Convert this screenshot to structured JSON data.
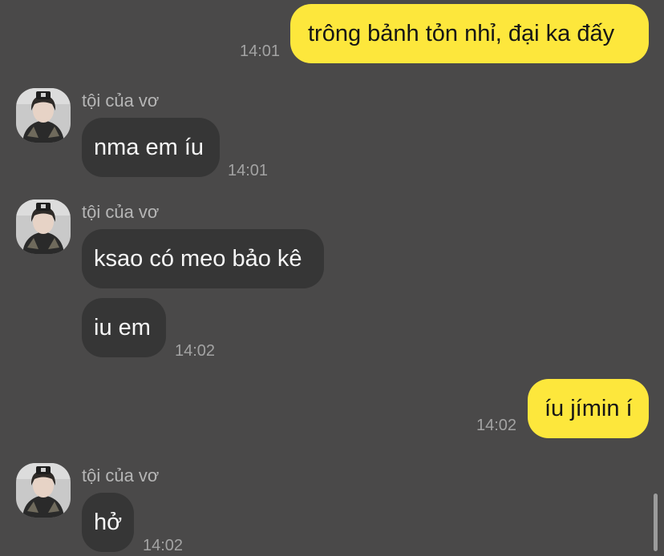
{
  "contact": {
    "name": "tội của vơ",
    "avatar_icon": "profile-photo-icon"
  },
  "messages": [
    {
      "direction": "out",
      "text": "trông bảnh tỏn nhỉ, đại ka đấy",
      "time": "14:01"
    },
    {
      "direction": "in",
      "text": "nma em íu",
      "time": "14:01"
    },
    {
      "direction": "in",
      "text": "ksao có meo bảo kê",
      "time": ""
    },
    {
      "direction": "in",
      "text": "iu em",
      "time": "14:02"
    },
    {
      "direction": "out",
      "text": "íu jímin í",
      "time": "14:02"
    },
    {
      "direction": "in",
      "text": "hở",
      "time": "14:02"
    }
  ],
  "colors": {
    "background": "#4a4949",
    "outgoing_bubble": "#fde73c",
    "incoming_bubble": "#363636",
    "timestamp": "#a3a3a3",
    "sender_name": "#b6b6b6"
  }
}
